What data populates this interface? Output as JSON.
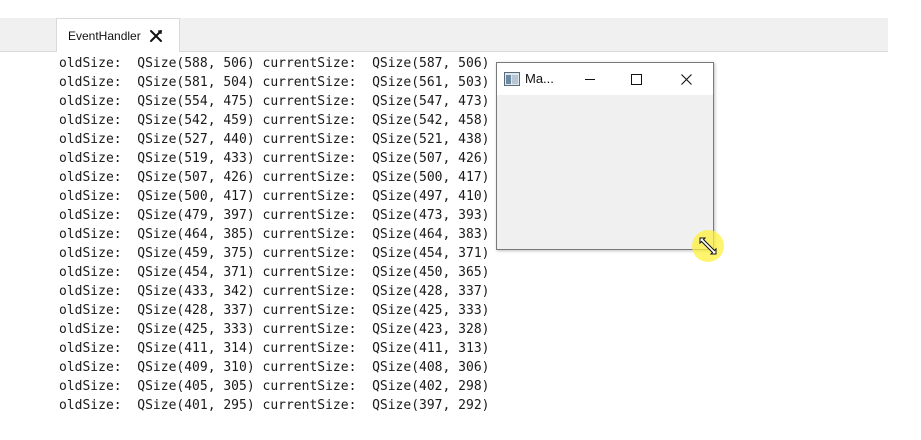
{
  "tab": {
    "label": "EventHandler"
  },
  "log": {
    "lines": [
      "oldSize:  QSize(588, 506) currentSize:  QSize(587, 506)",
      "oldSize:  QSize(581, 504) currentSize:  QSize(561, 503)",
      "oldSize:  QSize(554, 475) currentSize:  QSize(547, 473)",
      "oldSize:  QSize(542, 459) currentSize:  QSize(542, 458)",
      "oldSize:  QSize(527, 440) currentSize:  QSize(521, 438)",
      "oldSize:  QSize(519, 433) currentSize:  QSize(507, 426)",
      "oldSize:  QSize(507, 426) currentSize:  QSize(500, 417)",
      "oldSize:  QSize(500, 417) currentSize:  QSize(497, 410)",
      "oldSize:  QSize(479, 397) currentSize:  QSize(473, 393)",
      "oldSize:  QSize(464, 385) currentSize:  QSize(464, 383)",
      "oldSize:  QSize(459, 375) currentSize:  QSize(454, 371)",
      "oldSize:  QSize(454, 371) currentSize:  QSize(450, 365)",
      "oldSize:  QSize(433, 342) currentSize:  QSize(428, 337)",
      "oldSize:  QSize(428, 337) currentSize:  QSize(425, 333)",
      "oldSize:  QSize(425, 333) currentSize:  QSize(423, 328)",
      "oldSize:  QSize(411, 314) currentSize:  QSize(411, 313)",
      "oldSize:  QSize(409, 310) currentSize:  QSize(408, 306)",
      "oldSize:  QSize(405, 305) currentSize:  QSize(402, 298)",
      "oldSize:  QSize(401, 295) currentSize:  QSize(397, 292)"
    ]
  },
  "window": {
    "title": "Ma...",
    "app_icon": "qt-window-icon",
    "minimize_icon": "minimize-icon",
    "maximize_icon": "maximize-icon",
    "close_icon": "close-icon"
  },
  "cursor": {
    "icon": "resize-diagonal-cursor-icon",
    "highlight_color": "#fff03c"
  }
}
